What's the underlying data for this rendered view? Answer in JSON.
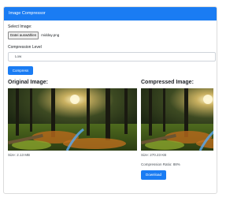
{
  "header": {
    "title": "Image Compressor"
  },
  "form": {
    "select_image_label": "Select Image:",
    "file_button_label": "Datei auswählen",
    "file_name": "midday.png",
    "compression_level_label": "Compression Level",
    "compression_level_value": "Low",
    "compress_button_label": "Compress"
  },
  "original": {
    "title": "Original Image:",
    "size_text": "Size: 2.13 MB"
  },
  "compressed": {
    "title": "Compressed Image:",
    "size_text": "Size: 270.23 KB",
    "ratio_text": "Compression Ratio: 88%",
    "download_button_label": "Download"
  },
  "colors": {
    "accent": "#1a7cf3",
    "header_text": "#ffffff"
  }
}
